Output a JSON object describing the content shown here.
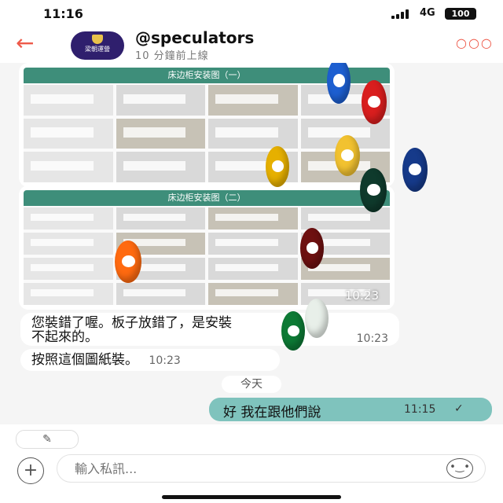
{
  "status_bar": {
    "time": "11:16",
    "network": "4G",
    "battery": "100"
  },
  "header": {
    "back_icon": "back-arrow-icon",
    "avatar_text": "梁朝運營",
    "channel_name": "@speculators",
    "last_online": "10 分鐘前上線",
    "more_icon": "more-dots-icon"
  },
  "chat": {
    "images": [
      {
        "title": "床边柜安装图（一）",
        "cells": 12
      },
      {
        "title": "床边柜安装图（二）",
        "cells": 16,
        "time": "10:23"
      }
    ],
    "messages": [
      {
        "text_line1": "您裝錯了喔。板子放錯了，是安裝",
        "text_line2": "不起來的。",
        "time": "10:23"
      },
      {
        "text": "按照這個圖紙裝。",
        "time": "10:23"
      }
    ],
    "date_divider": "今天",
    "my_message": {
      "text": "好 我在跟他們說",
      "time": "11:15",
      "status": "✓"
    }
  },
  "composer": {
    "compose_icon": "✎",
    "plus_icon": "+",
    "placeholder": "輸入私訊...",
    "emoji_icon": "•‿•"
  },
  "colors": {
    "accent": "#ee5a4a",
    "my_bubble": "#7fc3bd",
    "header_teal": "#3e8e7a"
  }
}
